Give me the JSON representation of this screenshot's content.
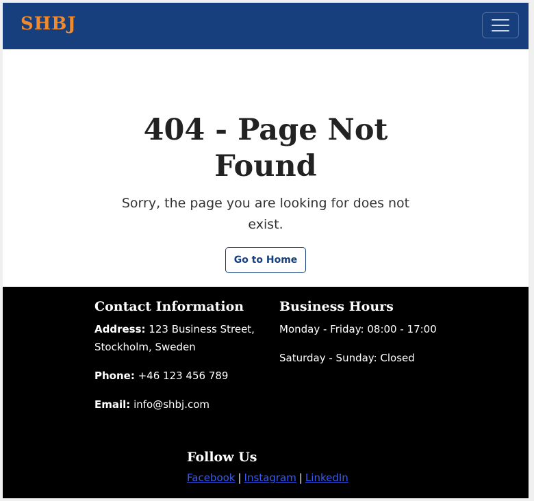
{
  "navbar": {
    "brand": "SHBJ",
    "toggle_icon": "hamburger-menu-icon"
  },
  "main": {
    "title": "404 - Page Not Found",
    "message": "Sorry, the page you are looking for does not exist.",
    "home_button": "Go to Home"
  },
  "footer": {
    "contact": {
      "heading": "Contact Information",
      "address_label": "Address:",
      "address_value": "123 Business Street, Stockholm, Sweden",
      "phone_label": "Phone:",
      "phone_value": "+46 123 456 789",
      "email_label": "Email:",
      "email_value": "info@shbj.com"
    },
    "hours": {
      "heading": "Business Hours",
      "weekdays": "Monday - Friday: 08:00 - 17:00",
      "weekend": "Saturday - Sunday: Closed"
    },
    "follow": {
      "heading": "Follow Us",
      "links": [
        "Facebook",
        "Instagram",
        "LinkedIn"
      ],
      "separator": "|"
    }
  },
  "colors": {
    "navbar_bg": "#173f7e",
    "brand": "#f08a2c",
    "footer_bg": "#000000",
    "link": "#3a5bf0"
  }
}
